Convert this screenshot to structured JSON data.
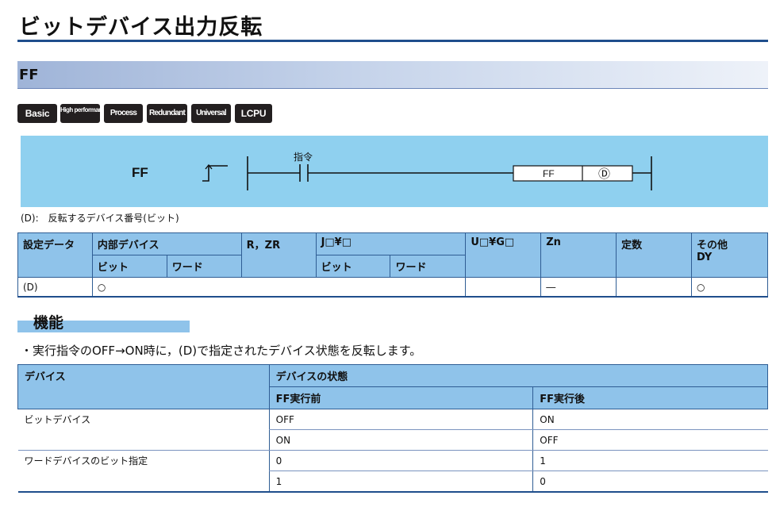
{
  "page_title": "ビットデバイス出力反転",
  "section_name": "FF",
  "badges": [
    "Basic",
    "High performance",
    "Process",
    "Redundant",
    "Universal",
    "LCPU"
  ],
  "ladder": {
    "label": "FF",
    "contact_label": "指令",
    "box_instruction": "FF",
    "box_operand": "Ⓓ"
  },
  "operand_note": "(D):　反転するデバイス番号(ビット)",
  "device_table": {
    "headers": {
      "setting_data": "設定データ",
      "internal_device": "内部デバイス",
      "bit": "ビット",
      "word": "ワード",
      "r_zr": "R，ZR",
      "j_device": "J□¥□",
      "j_bit": "ビット",
      "j_word": "ワード",
      "u_device": "U□¥G□",
      "zn": "Zn",
      "constant": "定数",
      "other": "その他",
      "other_dy": "DY"
    },
    "row": {
      "data": "(D)",
      "internal_bit": "○",
      "zn": "―",
      "other": "○"
    }
  },
  "function_title": "機能",
  "function_text": "・実行指令のOFF→ON時に，(D)で指定されたデバイス状態を反転します。",
  "state_table": {
    "headers": {
      "device": "デバイス",
      "state": "デバイスの状態",
      "before": "FF実行前",
      "after": "FF実行後"
    },
    "rows": [
      {
        "device": "ビットデバイス",
        "before": "OFF",
        "after": "ON"
      },
      {
        "device": "",
        "before": "ON",
        "after": "OFF"
      },
      {
        "device": "ワードデバイスのビット指定",
        "before": "0",
        "after": "1"
      },
      {
        "device": "",
        "before": "1",
        "after": "0"
      }
    ]
  },
  "colors": {
    "accent_rule": "#1f4e8c",
    "header_fill": "#8fc3ea",
    "ladder_fill": "#8fd0ef",
    "badge_fill": "#231f20"
  }
}
